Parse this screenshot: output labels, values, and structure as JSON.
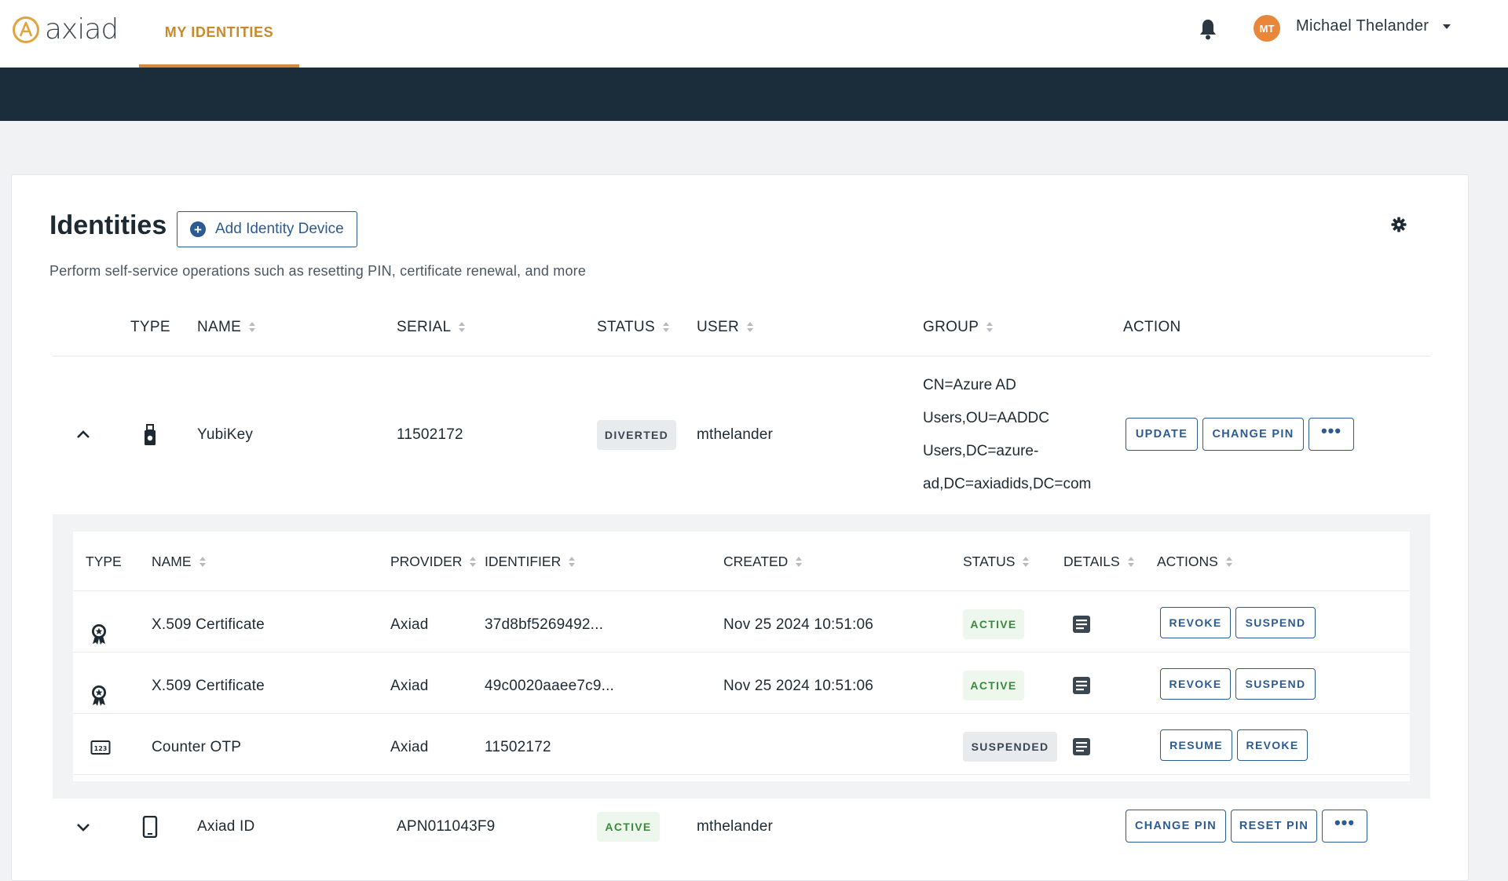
{
  "app": {
    "logo_text": "axiad",
    "nav_tab": "MY IDENTITIES",
    "user": {
      "initials": "MT",
      "name": "Michael Thelander"
    }
  },
  "page": {
    "title": "Identities",
    "add_button": "Add Identity Device",
    "subtitle": "Perform self-service operations such as resetting PIN, certificate renewal, and more"
  },
  "table": {
    "headers": {
      "type": "TYPE",
      "name": "NAME",
      "serial": "SERIAL",
      "status": "STATUS",
      "user": "USER",
      "group": "GROUP",
      "action": "ACTION"
    },
    "rows": [
      {
        "type_icon": "usb-key-icon",
        "name": "YubiKey",
        "serial": "11502172",
        "status": "DIVERTED",
        "user": "mthelander",
        "group_lines": [
          "CN=Azure AD",
          "Users,OU=AADDC",
          "Users,DC=azure-",
          "ad,DC=axiadids,DC=com"
        ],
        "actions": [
          "UPDATE",
          "CHANGE PIN",
          "•••"
        ],
        "expanded": true
      },
      {
        "type_icon": "mobile-phone-icon",
        "name": "Axiad ID",
        "serial": "APN011043F9",
        "status": "ACTIVE",
        "user": "mthelander",
        "actions": [
          "CHANGE PIN",
          "RESET PIN",
          "•••"
        ],
        "expanded": false
      }
    ]
  },
  "credentials": {
    "headers": {
      "type": "TYPE",
      "name": "NAME",
      "provider": "PROVIDER",
      "identifier": "IDENTIFIER",
      "created": "CREATED",
      "status": "STATUS",
      "details": "DETAILS",
      "actions": "ACTIONS"
    },
    "rows": [
      {
        "type_icon": "certificate-icon",
        "name": "X.509 Certificate",
        "provider": "Axiad",
        "identifier": "37d8bf5269492...",
        "created": "Nov 25 2024 10:51:06",
        "status": "ACTIVE",
        "actions": [
          "REVOKE",
          "SUSPEND"
        ]
      },
      {
        "type_icon": "certificate-icon",
        "name": "X.509 Certificate",
        "provider": "Axiad",
        "identifier": "49c0020aaee7c9...",
        "created": "Nov 25 2024 10:51:06",
        "status": "ACTIVE",
        "actions": [
          "REVOKE",
          "SUSPEND"
        ]
      },
      {
        "type_icon": "counter-otp-icon",
        "name": "Counter OTP",
        "provider": "Axiad",
        "identifier": "11502172",
        "created": "",
        "status": "SUSPENDED",
        "actions": [
          "RESUME",
          "REVOKE"
        ]
      }
    ]
  },
  "colors": {
    "accent": "#d48a3f",
    "banner": "#1b2d3a",
    "primary": "#2c5b92",
    "active": "#3a8a3e"
  }
}
